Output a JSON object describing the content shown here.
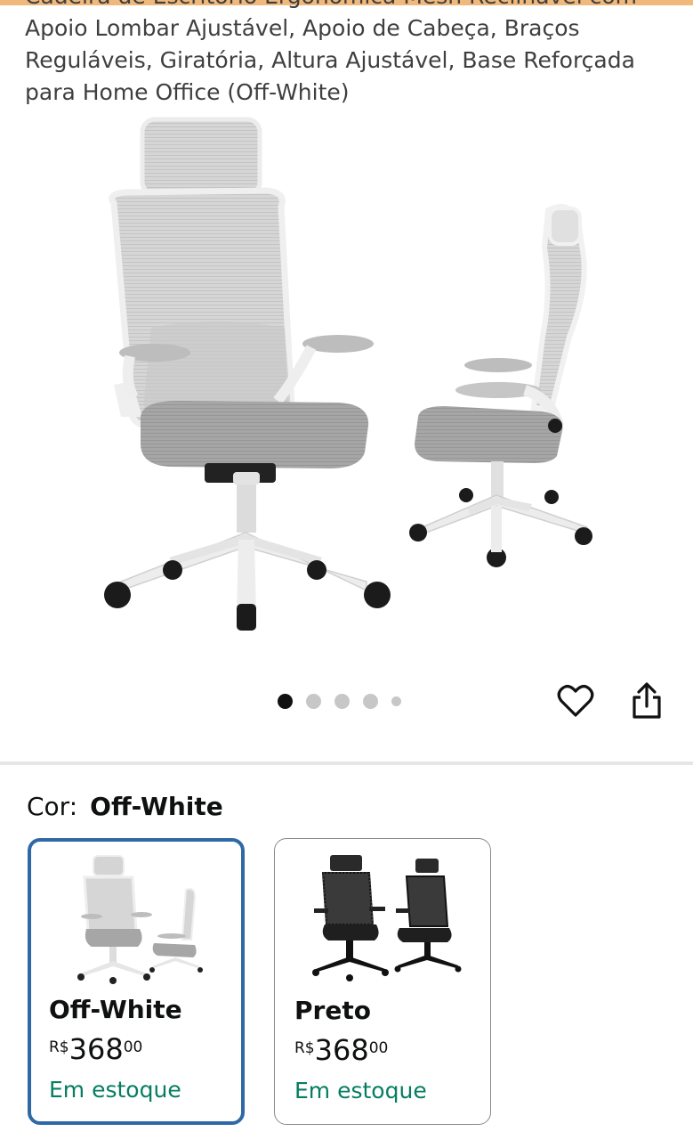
{
  "product": {
    "title": "Cadeira de Escritório Ergonômica Mesh Reclinável com Apoio Lombar Ajustável, Apoio de Cabeça, Braços Reguláveis, Giratória, Altura Ajustável, Base Reforçada para Home Office (Off-White)"
  },
  "gallery": {
    "image_count": 5,
    "active_index": 0
  },
  "actions": {
    "wishlist_icon": "heart-icon",
    "share_icon": "share-icon"
  },
  "variation": {
    "label": "Cor:",
    "selected_value": "Off-White",
    "options": [
      {
        "name": "Off-White",
        "currency": "R$",
        "price_whole": "368",
        "price_fraction": "00",
        "availability": "Em estoque",
        "selected": true
      },
      {
        "name": "Preto",
        "currency": "R$",
        "price_whole": "368",
        "price_fraction": "00",
        "availability": "Em estoque",
        "selected": false
      }
    ]
  },
  "colors": {
    "accent_top": "#f0b87a",
    "selected_border": "#2e69a6",
    "in_stock": "#067d62"
  }
}
